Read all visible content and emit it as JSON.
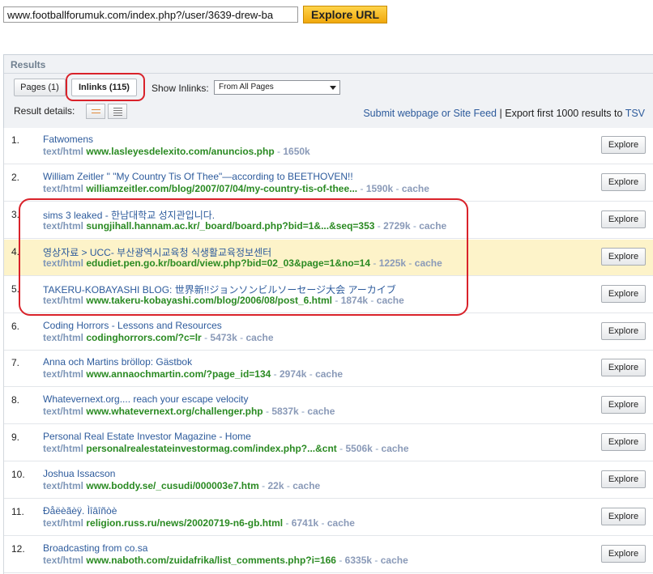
{
  "urlbar": {
    "value": "www.footballforumuk.com/index.php?/user/3639-drew-ba",
    "button": "Explore URL"
  },
  "panel": {
    "title": "Results",
    "tabs": [
      {
        "label": "Pages (1)"
      },
      {
        "label": "Inlinks (115)"
      }
    ],
    "show_inlinks_label": "Show Inlinks:",
    "show_inlinks_value": "From All Pages",
    "result_details_label": "Result details:",
    "submit_link": "Submit webpage or Site Feed",
    "separator": "|",
    "export_text": "Export first 1000 results to",
    "export_link": "TSV"
  },
  "results": [
    {
      "num": "1.",
      "title": "Fatwomens",
      "mime": "text/html",
      "url": "www.lasleyesdelexito.com/anuncios.php",
      "size": "1650k",
      "cache": ""
    },
    {
      "num": "2.",
      "title": "William Zeitler \" \"My Country Tis Of Thee\"—according to BEETHOVEN!!",
      "mime": "text/html",
      "url": "williamzeitler.com/blog/2007/07/04/my-country-tis-of-thee...",
      "size": "1590k",
      "cache": "cache"
    },
    {
      "num": "3.",
      "title": "sims 3 leaked - 한남대학교 성지관입니다.",
      "mime": "text/html",
      "url": "sungjihall.hannam.ac.kr/_board/board.php?bid=1&...&seq=353",
      "size": "2729k",
      "cache": "cache"
    },
    {
      "num": "4.",
      "title": "영상자료 > UCC- 부산광역시교육청 식생활교육정보센터",
      "mime": "text/html",
      "url": "edudiet.pen.go.kr/board/view.php?bid=02_03&page=1&no=14",
      "size": "1225k",
      "cache": "cache"
    },
    {
      "num": "5.",
      "title": "TAKERU-KOBAYASHI BLOG: 世界新!!ジョンソンビルソーセージ大会 アーカイブ",
      "mime": "text/html",
      "url": "www.takeru-kobayashi.com/blog/2006/08/post_6.html",
      "size": "1874k",
      "cache": "cache"
    },
    {
      "num": "6.",
      "title": "Coding Horrors - Lessons and Resources",
      "mime": "text/html",
      "url": "codinghorrors.com/?c=lr",
      "size": "5473k",
      "cache": "cache"
    },
    {
      "num": "7.",
      "title": "Anna och Martins bröllop: Gästbok",
      "mime": "text/html",
      "url": "www.annaochmartin.com/?page_id=134",
      "size": "2974k",
      "cache": "cache"
    },
    {
      "num": "8.",
      "title": "Whatevernext.org.... reach your escape velocity",
      "mime": "text/html",
      "url": "www.whatevernext.org/challenger.php",
      "size": "5837k",
      "cache": "cache"
    },
    {
      "num": "9.",
      "title": "Personal Real Estate Investor Magazine - Home",
      "mime": "text/html",
      "url": "personalrealestateinvestormag.com/index.php?...&cnt",
      "size": "5506k",
      "cache": "cache"
    },
    {
      "num": "10.",
      "title": "Joshua Issacson",
      "mime": "text/html",
      "url": "www.boddy.se/_cusudi/000003e7.htm",
      "size": "22k",
      "cache": "cache"
    },
    {
      "num": "11.",
      "title": "Ðåëèãèÿ. Ìîâîñòè",
      "mime": "text/html",
      "url": "religion.russ.ru/news/20020719-n6-gb.html",
      "size": "6741k",
      "cache": "cache"
    },
    {
      "num": "12.",
      "title": "Broadcasting from co.sa",
      "mime": "text/html",
      "url": "www.naboth.com/zuidafrika/list_comments.php?i=166",
      "size": "6335k",
      "cache": "cache"
    }
  ],
  "row_button": "Explore",
  "dash": "-",
  "highlighted_row": 4
}
